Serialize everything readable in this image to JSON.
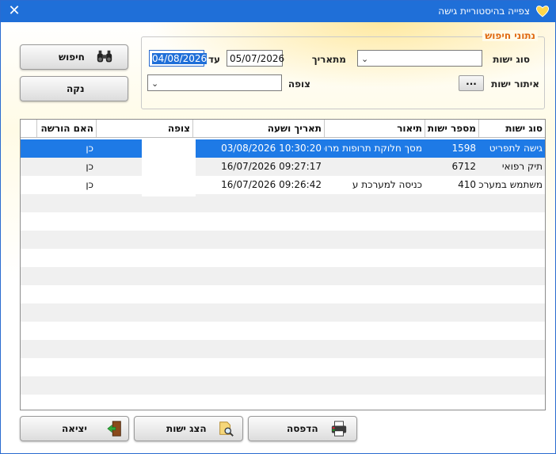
{
  "window": {
    "title": "צפייה בהיסטוריית גישה",
    "close_glyph": "✕"
  },
  "buttons": {
    "search": "חיפוש",
    "clear": "נקה",
    "exit": "יציאה",
    "show_entity": "הצג ישות",
    "print": "הדפסה"
  },
  "search": {
    "group_title": "נתוני חיפוש",
    "from_label": "מתאריך",
    "from_value": "05/07/2026",
    "to_label": "עד",
    "to_value": "04/08/2026",
    "entity_type_label": "סוג ישות",
    "entity_type_value": "",
    "viewer_label": "צופה",
    "viewer_value": "",
    "locate_label": "איתור ישות",
    "locate_button": "..."
  },
  "table": {
    "columns": [
      "סוג ישות",
      "מספר ישות",
      "תיאור",
      "תאריך ושעה",
      "צופה",
      "האם הורשה"
    ],
    "rows": [
      {
        "type": "גישה לתפריט",
        "number": "1598",
        "description": "מסך חלוקת תרופות מרוכז",
        "datetime": "03/08/2026 10:30:20",
        "viewer": "",
        "allowed": "כן"
      },
      {
        "type": "תיק רפואי",
        "number": "6712",
        "description": "",
        "datetime": "16/07/2026 09:27:17",
        "viewer": "",
        "allowed": "כן"
      },
      {
        "type": "משתמש במערכת",
        "number": "410",
        "description": "כניסה למערכת ע\"י",
        "datetime": "16/07/2026 09:26:42",
        "viewer": "",
        "allowed": "כן"
      }
    ]
  },
  "colors": {
    "titlebar": "#1f6fd8",
    "selected_row": "#1e7ae6",
    "group_title": "#e06a12"
  },
  "icons": {
    "app": "heart-logo-icon",
    "search": "binoculars-icon",
    "exit": "door-exit-icon",
    "show_entity": "folder-magnifier-icon",
    "print": "printer-icon"
  }
}
